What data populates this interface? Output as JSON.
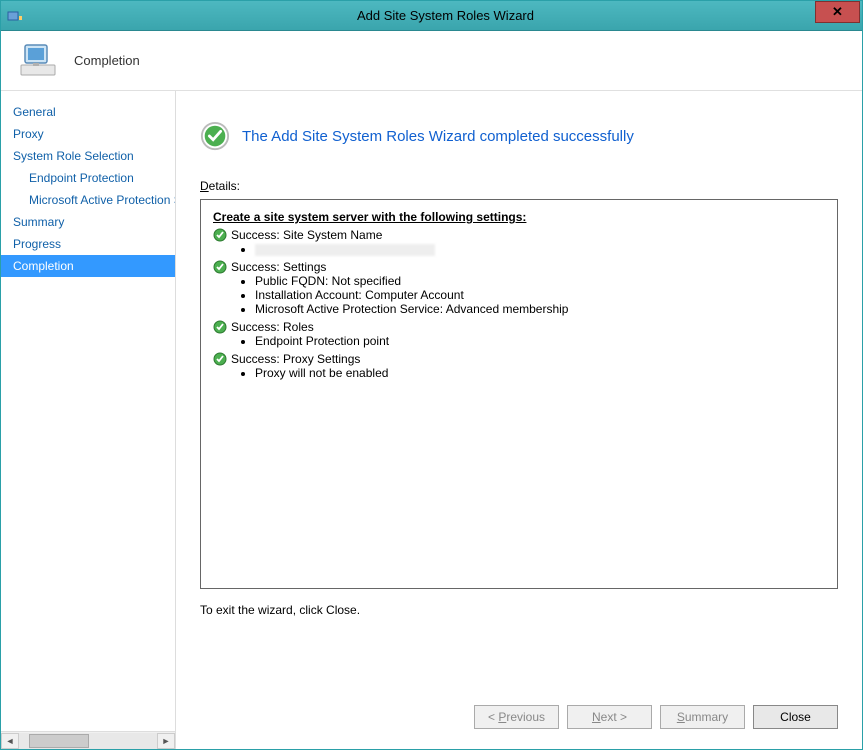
{
  "titlebar": {
    "title": "Add Site System Roles Wizard"
  },
  "header": {
    "title": "Completion"
  },
  "nav": {
    "items": [
      {
        "label": "General",
        "sub": false,
        "active": false
      },
      {
        "label": "Proxy",
        "sub": false,
        "active": false
      },
      {
        "label": "System Role Selection",
        "sub": false,
        "active": false
      },
      {
        "label": "Endpoint Protection",
        "sub": true,
        "active": false
      },
      {
        "label": "Microsoft Active Protection Service",
        "sub": true,
        "active": false
      },
      {
        "label": "Summary",
        "sub": false,
        "active": false
      },
      {
        "label": "Progress",
        "sub": false,
        "active": false
      },
      {
        "label": "Completion",
        "sub": false,
        "active": true
      }
    ]
  },
  "main": {
    "success_message": "The Add Site System Roles Wizard completed successfully",
    "details_label": "Details:",
    "details_heading": "Create a site system server with the following settings:",
    "results": [
      {
        "label": "Success: Site System Name",
        "bullets": [
          ""
        ]
      },
      {
        "label": "Success: Settings",
        "bullets": [
          "Public FQDN: Not specified",
          "Installation Account: Computer Account",
          "Microsoft Active Protection Service: Advanced membership"
        ]
      },
      {
        "label": "Success: Roles",
        "bullets": [
          "Endpoint Protection point"
        ]
      },
      {
        "label": "Success: Proxy Settings",
        "bullets": [
          "Proxy will not be enabled"
        ]
      }
    ],
    "exit_hint": "To exit the wizard, click Close."
  },
  "buttons": {
    "previous": "< Previous",
    "next": "Next >",
    "summary": "Summary",
    "close": "Close"
  }
}
